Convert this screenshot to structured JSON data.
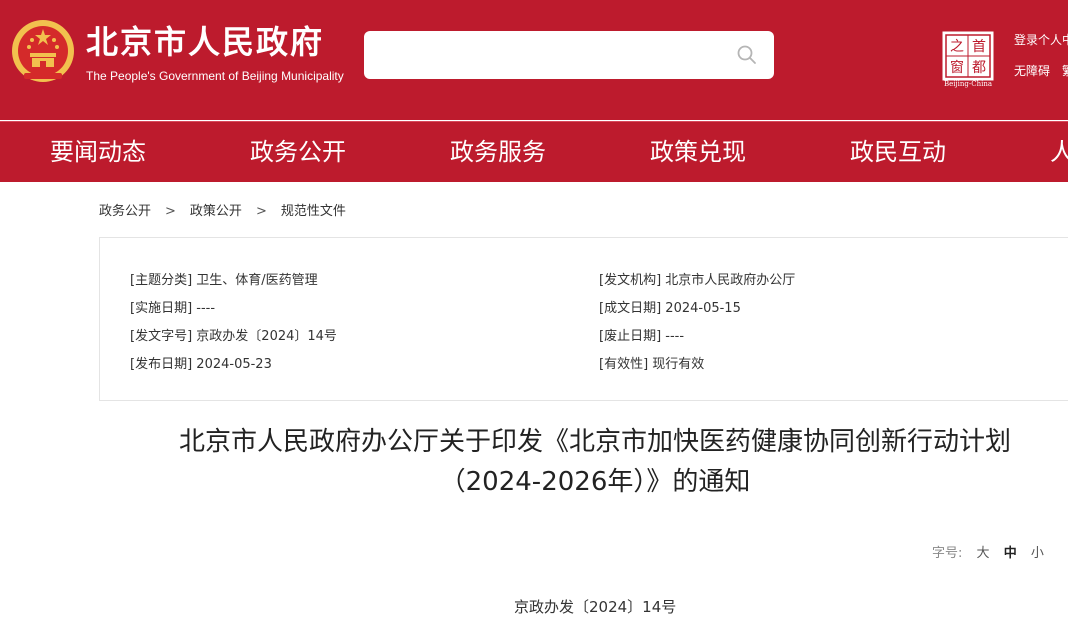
{
  "header": {
    "site_title": "北京市人民政府",
    "site_subtitle": "The People's Government of Beijing Municipality",
    "search": {
      "placeholder": "",
      "value": ""
    },
    "cap_logo_chars": [
      "之",
      "首",
      "窗",
      "都"
    ],
    "cap_logo_caption": "Beijing-China",
    "login_label": "登录个人中",
    "accessibility_label": "无障碍",
    "accessibility_extra": "繁",
    "icons": {
      "emblem": "national-emblem-icon",
      "search": "search-icon"
    },
    "colors": {
      "brand_red": "#bd1b2d",
      "gold": "#f2c14e"
    }
  },
  "nav": {
    "items": [
      "要闻动态",
      "政务公开",
      "政务服务",
      "政策兑现",
      "政民互动",
      "人"
    ]
  },
  "breadcrumb": {
    "items": [
      "政务公开",
      "政策公开",
      "规范性文件"
    ],
    "separator": ">"
  },
  "info": {
    "left": [
      {
        "label": "[主题分类]",
        "value": "卫生、体育/医药管理"
      },
      {
        "label": "[实施日期]",
        "value": "----"
      },
      {
        "label": "[发文字号]",
        "value": "京政办发〔2024〕14号"
      },
      {
        "label": "[发布日期]",
        "value": "2024-05-23"
      }
    ],
    "right": [
      {
        "label": "[发文机构]",
        "value": "北京市人民政府办公厅"
      },
      {
        "label": "[成文日期]",
        "value": "2024-05-15"
      },
      {
        "label": "[废止日期]",
        "value": "----"
      },
      {
        "label": "[有效性]",
        "value": "现行有效"
      }
    ]
  },
  "document": {
    "title_line1": "北京市人民政府办公厅关于印发《北京市加快医药健康协同创新行动计划",
    "title_line2": "（2024-2026年）》的通知",
    "font_size_label": "字号:",
    "font_sizes": [
      "大",
      "中",
      "小"
    ],
    "font_size_selected": "中",
    "doc_number": "京政办发〔2024〕14号"
  }
}
